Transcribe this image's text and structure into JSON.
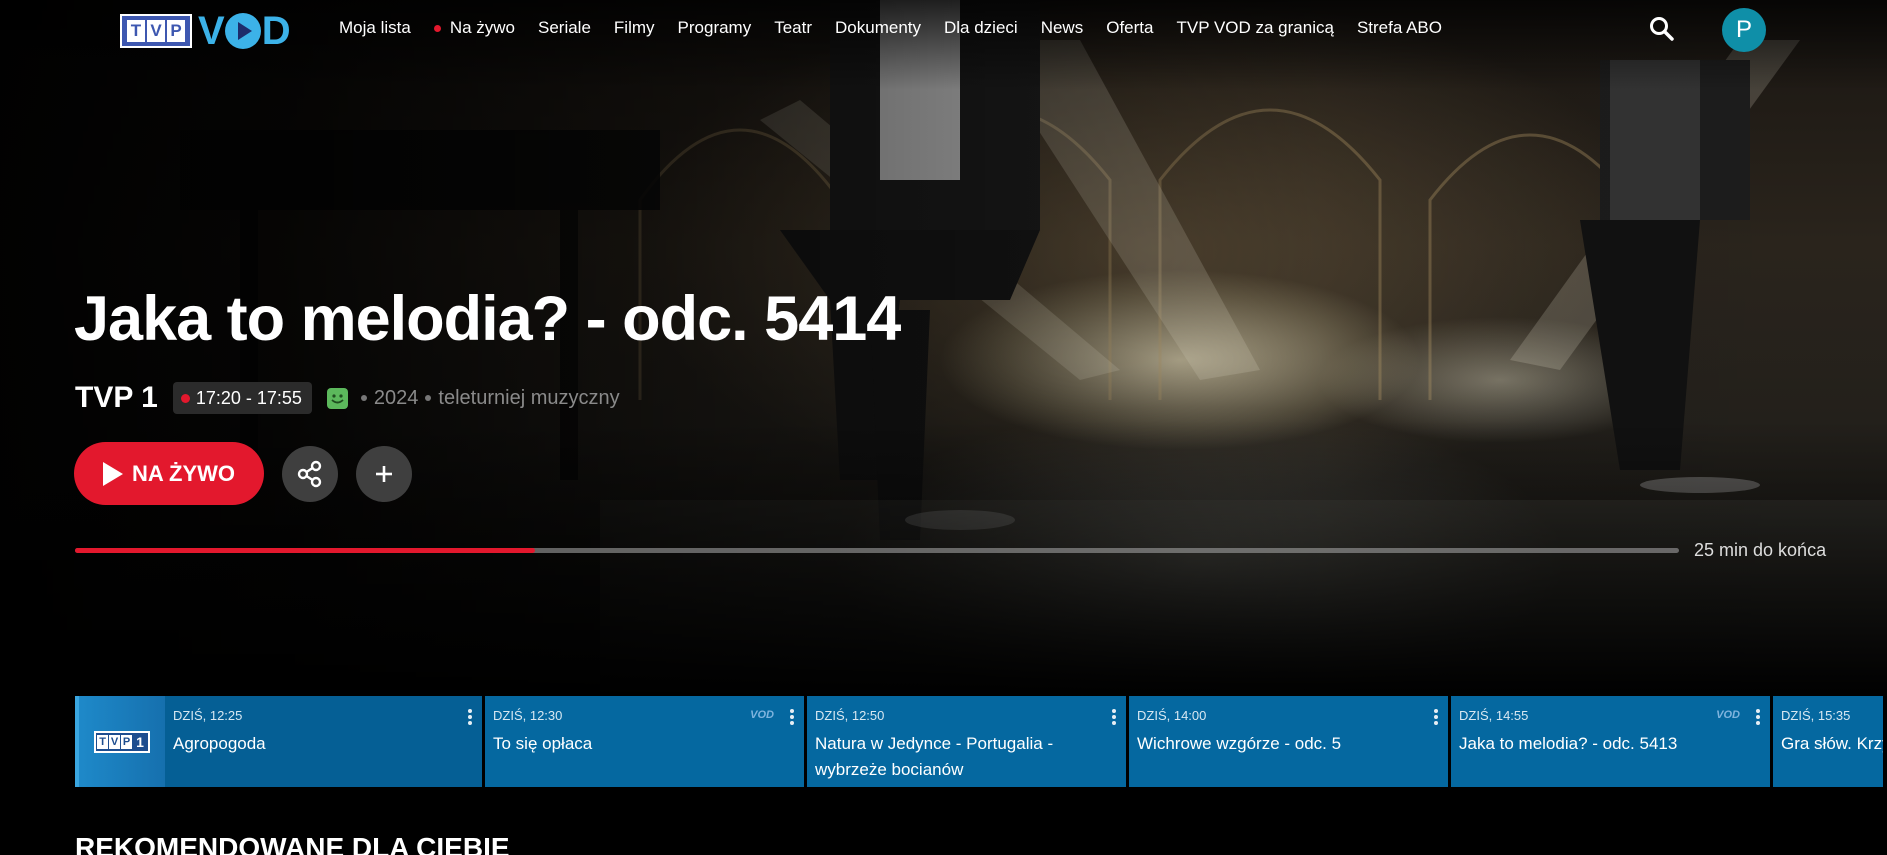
{
  "header": {
    "nav": [
      "Moja lista",
      "Na żywo",
      "Seriale",
      "Filmy",
      "Programy",
      "Teatr",
      "Dokumenty",
      "Dla dzieci",
      "News",
      "Oferta",
      "TVP VOD za granicą",
      "Strefa ABO"
    ],
    "live_nav_index": 1,
    "avatar_initial": "P"
  },
  "hero": {
    "title": "Jaka to melodia? - odc. 5414",
    "channel": "TVP 1",
    "time_range": "17:20 - 17:55",
    "year": "2024",
    "genre": "teleturniej muzyczny",
    "live_button_label": "NA ŻYWO",
    "progress_fraction": 0.287,
    "remaining_label": "25 min do końca"
  },
  "epg": [
    {
      "time": "DZIŚ, 12:25",
      "title": "Agropogoda",
      "vod": false
    },
    {
      "time": "DZIŚ, 12:30",
      "title": "To się opłaca",
      "vod": true
    },
    {
      "time": "DZIŚ, 12:50",
      "title": "Natura w Jedynce - Portugalia - wybrzeże bocianów",
      "vod": false
    },
    {
      "time": "DZIŚ, 14:00",
      "title": "Wichrowe wzgórze - odc. 5",
      "vod": false
    },
    {
      "time": "DZIŚ, 14:55",
      "title": "Jaka to melodia? - odc. 5413",
      "vod": true
    },
    {
      "time": "DZIŚ, 15:35",
      "title": "Gra słów. Krzyżówka",
      "vod": false
    }
  ],
  "section_title": "REKOMENDOWANE DLA CIEBIE",
  "colors": {
    "accent": "#e3182d",
    "epg_bg": "#0568a0",
    "vod": "#3cb2e8"
  }
}
